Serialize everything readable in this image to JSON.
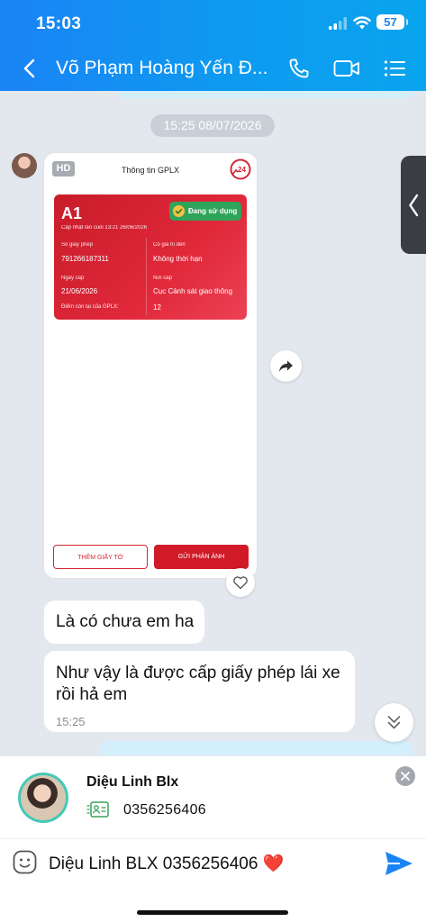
{
  "status_bar": {
    "time": "15:03",
    "battery": "57"
  },
  "header": {
    "contact_name": "Võ Phạm Hoàng Yến Đ..."
  },
  "chat": {
    "date_divider": "15:25 08/07/2026",
    "gplx_card": {
      "hd_badge": "HD",
      "title": "Thông tin GPLX",
      "logo_text": "24",
      "license": {
        "class": "A1",
        "last_updated": "Cập nhật lần cuối 13:21 26/06/2026",
        "status": "Đang sử dụng",
        "license_number_label": "Số giấy phép",
        "license_number": "791266187311",
        "validity_label": "Có giá trị đến",
        "validity": "Không thời hạn",
        "issue_date_label": "Ngày cấp",
        "issue_date": "21/06/2026",
        "issuer_label": "Nơi cấp",
        "issuer": "Cục Cảnh sát giao thông",
        "points_label": "Điểm còn lại của GPLX:",
        "points": "12"
      },
      "add_document_button": "THÊM GIẤY TỜ",
      "send_feedback_button": "GỬI PHẢN ÁNH"
    },
    "messages": [
      {
        "text": "Là có chưa em ha"
      },
      {
        "text": "Như vậy là được cấp giấy phép lái xe rồi hả em",
        "time": "15:25"
      }
    ]
  },
  "contact_preview": {
    "name": "Diệu Linh Blx",
    "phone": "0356256406"
  },
  "composer": {
    "value": "Diệu Linh BLX 0356256406 ❤️"
  },
  "colors": {
    "header_blue": "#1a84f5",
    "license_red": "#d11a28",
    "status_green": "#2ea45a",
    "accent_send": "#1a84f5"
  }
}
